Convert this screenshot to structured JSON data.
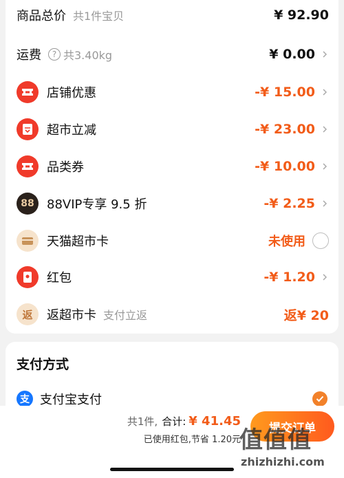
{
  "summary": {
    "goods_total": {
      "label": "商品总价",
      "sub": "共1件宝贝",
      "amount": "¥ 92.90"
    },
    "shipping": {
      "label": "运费",
      "help_icon": "question-icon",
      "help_text": "共3.40kg",
      "amount": "¥ 0.00"
    },
    "discounts": [
      {
        "label": "店铺优惠",
        "amount": "-¥ 15.00",
        "icon": "ticket-icon"
      },
      {
        "label": "超市立减",
        "amount": "-¥ 23.00",
        "icon": "coupon-icon"
      },
      {
        "label": "品类券",
        "amount": "-¥ 10.00",
        "icon": "ticket-icon"
      },
      {
        "label": "88VIP专享 9.5 折",
        "amount": "-¥ 2.25",
        "icon": "88vip-icon"
      },
      {
        "label": "天猫超市卡",
        "amount": "未使用",
        "icon": "card-icon"
      },
      {
        "label": "红包",
        "amount": "-¥ 1.20",
        "icon": "red-packet-icon"
      },
      {
        "label": "返超市卡",
        "sub": "支付立返",
        "amount": "返¥ 20",
        "icon": "rebate-icon",
        "icon_text": "返"
      }
    ],
    "vip_icon_text": "88"
  },
  "payment": {
    "title": "支付方式",
    "method": {
      "label": "支付宝支付",
      "icon_text": "支"
    }
  },
  "bottom_bar": {
    "count": "共1件,",
    "total_label": "合计:",
    "total": "¥ 41.45",
    "savings_note": "已使用红包,节省 1.20元",
    "submit_label": "提交订单"
  },
  "watermark": {
    "logo": "值值值",
    "text": "zhizhizhi.com"
  },
  "colors": {
    "accent": "#f25c19",
    "brand_red": "#f03a2a",
    "alipay_blue": "#1677ff"
  }
}
